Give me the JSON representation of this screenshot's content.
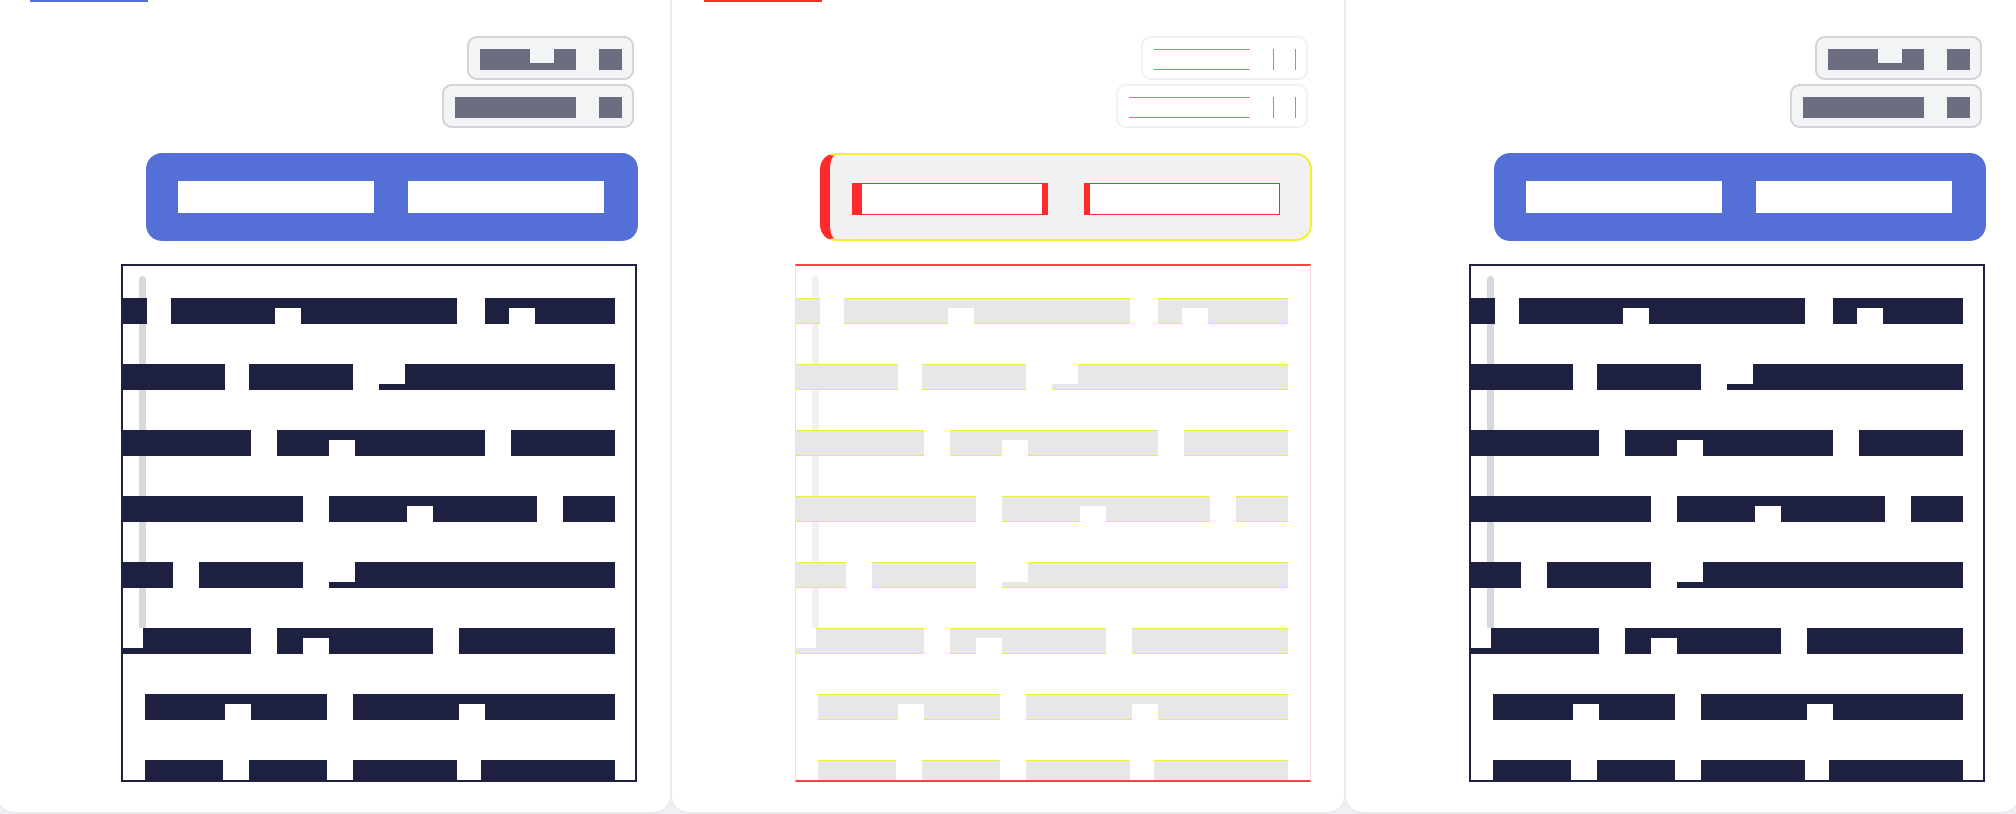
{
  "panels": [
    {
      "id": "panel-left",
      "variant": "render"
    },
    {
      "id": "panel-center",
      "variant": "debug-overlay"
    },
    {
      "id": "panel-right",
      "variant": "render"
    }
  ],
  "colors": {
    "accent_blue": "#5470d6",
    "text_dark": "#1d2040",
    "pill_text": "#6a6e80",
    "debug_red": "#ff2a2a",
    "debug_yellow": "#f3eb3a"
  },
  "icons": {
    "pill_glyph": "square-icon"
  },
  "editor": {
    "line_count": 8
  }
}
